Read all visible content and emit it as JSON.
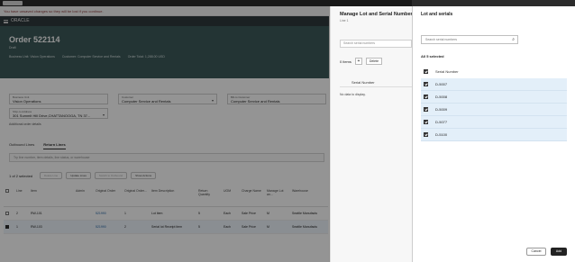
{
  "app": {
    "notice": "You have unsaved changes so they will be lost if you continue.",
    "brand": "ORACLE",
    "order_title": "Order 522114",
    "order_status": "Draft",
    "order_meta": [
      "Business Unit: Vision Operations",
      "Customer: Computer Service and Rentals",
      "Order Total: 1,288.00 USD"
    ],
    "fields": [
      {
        "label": "Business Unit",
        "value": "Vision Operations"
      },
      {
        "label": "Customer",
        "value": "Computer Service and Rentals"
      },
      {
        "label": "Bill-to Customer",
        "value": "Computer Service and Rentals"
      },
      {
        "label": "Ship-to Address",
        "value": "301 Summit Hill Drive,CHATTANOOGA, TN 37..."
      }
    ],
    "additional_details": "Additional order details",
    "tabs": [
      "Outbound Lines",
      "Return Lines"
    ],
    "search_placeholder": "Try line number, item details, line status, or warehouse",
    "toolbar": {
      "selected": "1 of 2 selected",
      "buttons": [
        "Delete Line",
        "Update Lines",
        "Switch to Outbound",
        "Show Actions"
      ]
    },
    "grid": {
      "headers": [
        "Line",
        "Item",
        "Admin",
        "Original Order",
        "Original Order...",
        "Item Description",
        "Return Quantity",
        "UOM",
        "Charge Name",
        "Manage Lot an...",
        "Warehouse"
      ],
      "rows": [
        {
          "line": "2",
          "item": "RW-101",
          "orig_order": "521990",
          "orig_line": "1",
          "desc": "Lot item",
          "qty": "5",
          "uom": "Each",
          "charge": "Sale Price",
          "manage": "M",
          "warehouse": "Seattle Manufactu",
          "selected": false
        },
        {
          "line": "1",
          "item": "RW-103",
          "orig_order": "521990",
          "orig_line": "2",
          "desc": "Serial lot Receipt item",
          "qty": "5",
          "uom": "Each",
          "charge": "Sale Price",
          "manage": "M",
          "warehouse": "Seattle Manufactu",
          "selected": true
        }
      ]
    }
  },
  "manage_panel": {
    "title": "Manage Lot and Serial Numbers",
    "subtitle": "Line 1",
    "search_placeholder": "Search serial numbers",
    "items_count": "0 items",
    "add": "+",
    "delete": "Delete",
    "column": "Serial Number",
    "empty": "No data to display."
  },
  "lot_panel": {
    "title": "Lot and serials",
    "search_placeholder": "Search serial numbers",
    "selected_label": "All 5 selected",
    "column": "Serial Number",
    "serials": [
      "D-5007",
      "D-5008",
      "D-5009",
      "D-5077",
      "D-5100"
    ],
    "cancel": "Cancel",
    "add": "Add"
  }
}
